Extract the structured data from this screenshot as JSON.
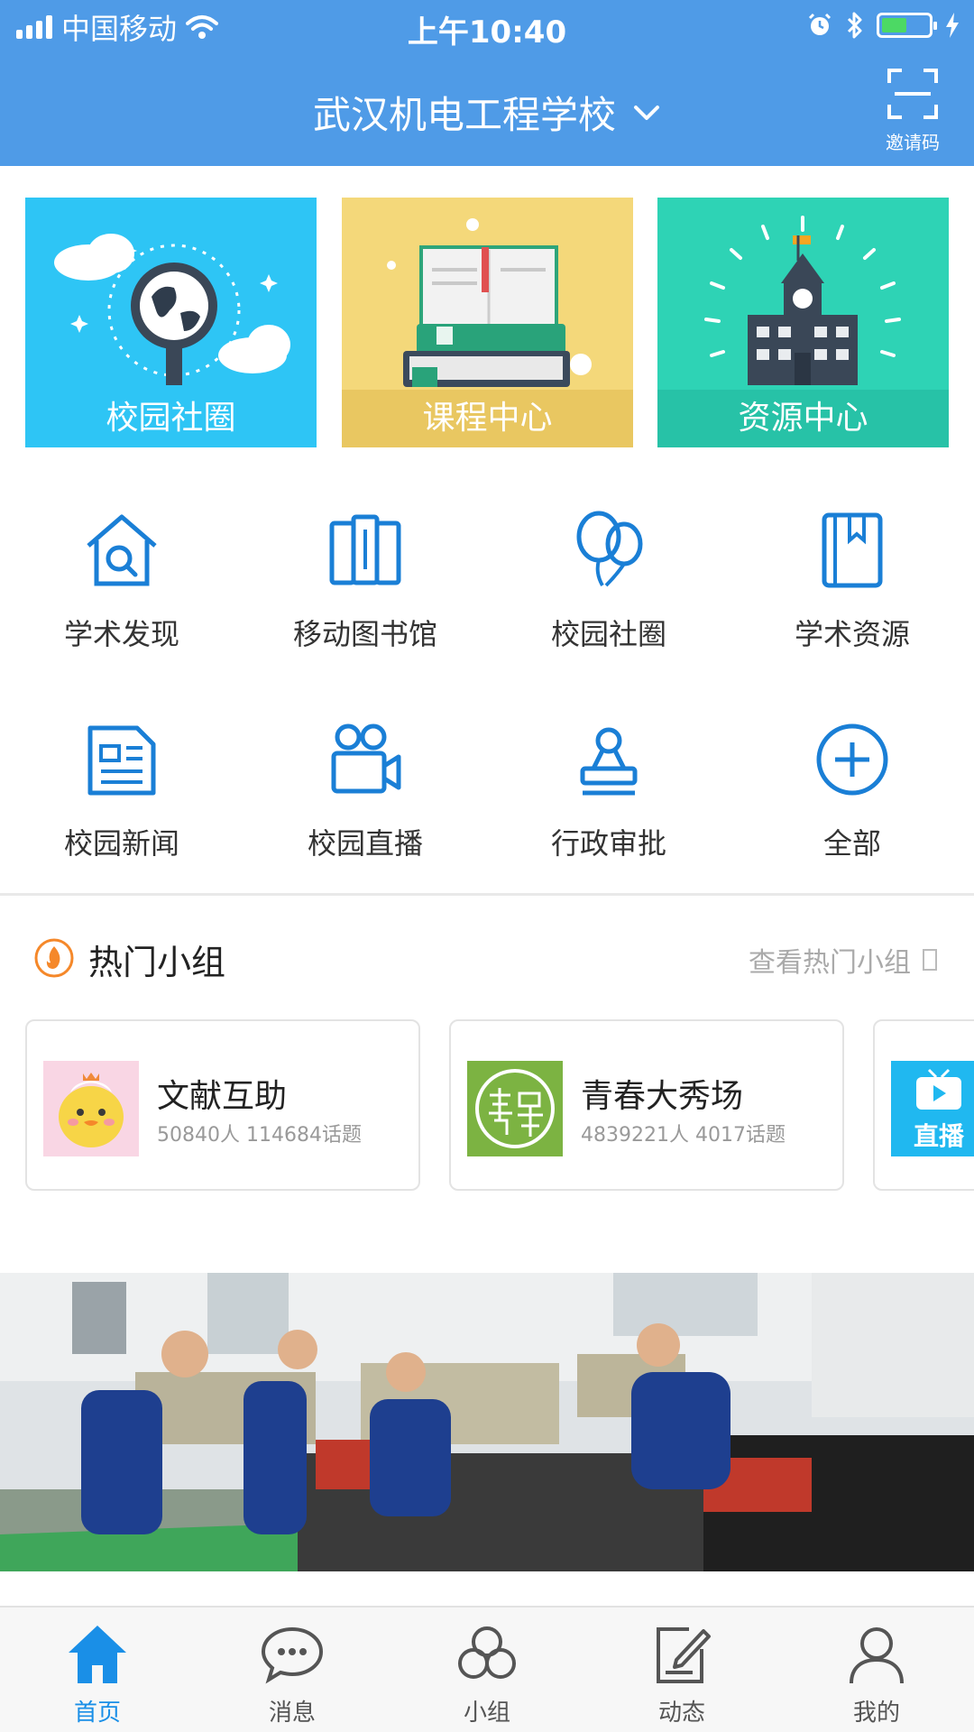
{
  "status_bar": {
    "carrier": "中国移动",
    "time": "上午10:40"
  },
  "nav": {
    "title": "武汉机电工程学校",
    "invite_label": "邀请码"
  },
  "banners": [
    {
      "label": "校园社圈"
    },
    {
      "label": "课程中心"
    },
    {
      "label": "资源中心"
    }
  ],
  "grid": [
    {
      "label": "学术发现",
      "icon": "house-search-icon"
    },
    {
      "label": "移动图书馆",
      "icon": "books-icon"
    },
    {
      "label": "校园社圈",
      "icon": "balloons-icon"
    },
    {
      "label": "学术资源",
      "icon": "bookmark-book-icon"
    },
    {
      "label": "校园新闻",
      "icon": "newspaper-icon"
    },
    {
      "label": "校园直播",
      "icon": "video-camera-icon"
    },
    {
      "label": "行政审批",
      "icon": "stamp-icon"
    },
    {
      "label": "全部",
      "icon": "plus-circle-icon"
    }
  ],
  "hot_groups": {
    "title": "热门小组",
    "more_label": "查看热门小组",
    "groups": [
      {
        "name": "文献互助",
        "meta": "50840人 114684话题"
      },
      {
        "name": "青春大秀场",
        "meta": "4839221人 4017话题"
      },
      {
        "badge": "直播"
      }
    ]
  },
  "tabs": [
    {
      "label": "首页",
      "icon": "home-icon",
      "active": true
    },
    {
      "label": "消息",
      "icon": "chat-bubble-icon",
      "active": false
    },
    {
      "label": "小组",
      "icon": "group-cloud-icon",
      "active": false
    },
    {
      "label": "动态",
      "icon": "edit-note-icon",
      "active": false
    },
    {
      "label": "我的",
      "icon": "user-icon",
      "active": false
    }
  ],
  "colors": {
    "primary": "#4f9be7",
    "icon_blue": "#1a7fd6",
    "banner_blue": "#2ec5f5",
    "banner_yellow": "#f4d87a",
    "banner_teal": "#2ed3b5",
    "fire_orange": "#f5882a"
  }
}
